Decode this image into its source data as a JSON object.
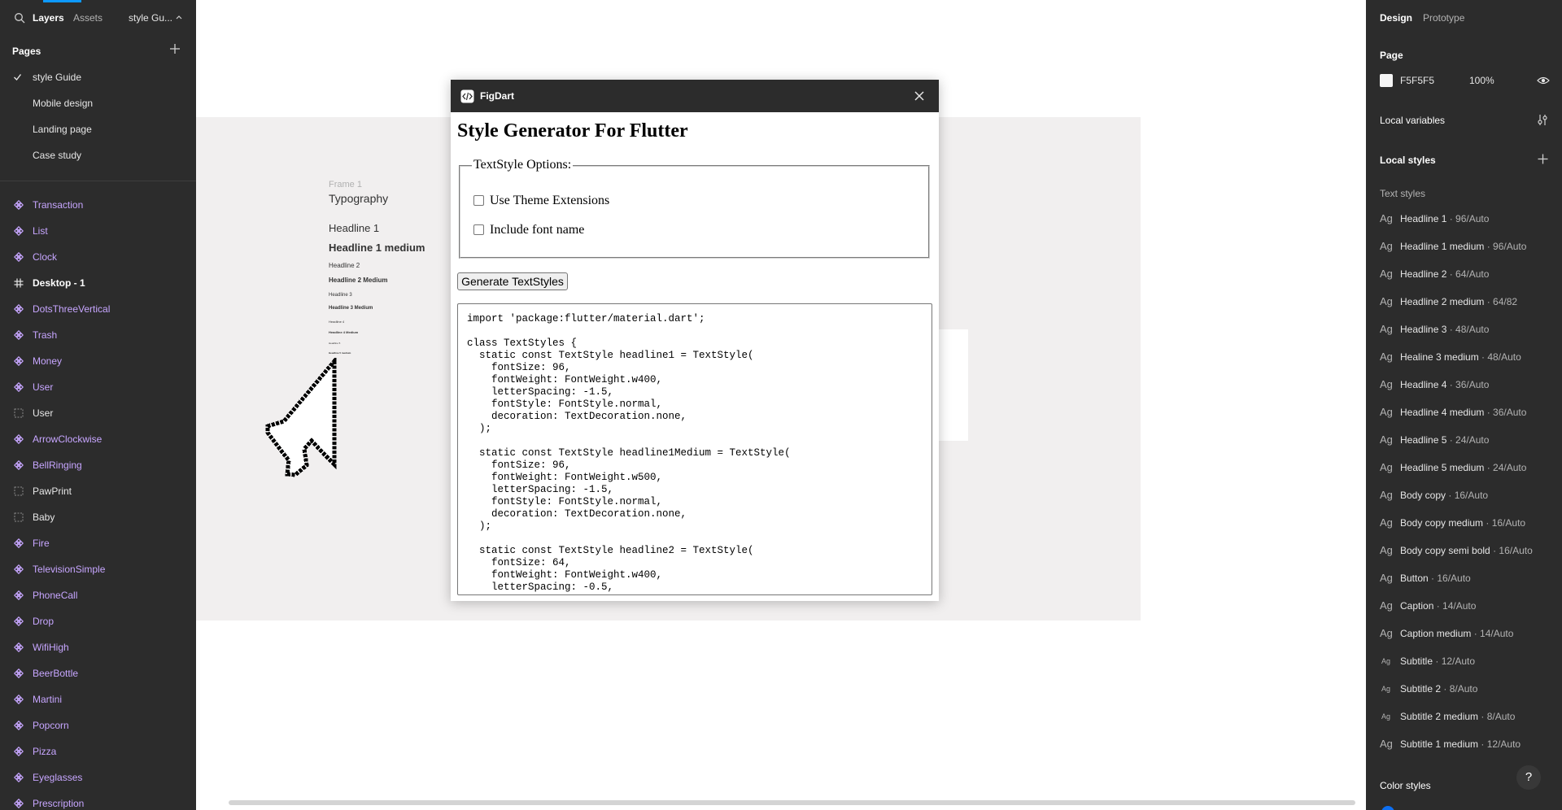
{
  "left_panel": {
    "tabs": {
      "layers": "Layers",
      "assets": "Assets"
    },
    "file_name": "style Gu...",
    "pages_heading": "Pages",
    "pages": [
      {
        "label": "style Guide",
        "selected": true
      },
      {
        "label": "Mobile design",
        "selected": false
      },
      {
        "label": "Landing page",
        "selected": false
      },
      {
        "label": "Case study",
        "selected": false
      }
    ],
    "layers": [
      {
        "label": "Transaction",
        "kind": "component"
      },
      {
        "label": "List",
        "kind": "component"
      },
      {
        "label": "Clock",
        "kind": "component"
      },
      {
        "label": "Desktop - 1",
        "kind": "frame"
      },
      {
        "label": "DotsThreeVertical",
        "kind": "component"
      },
      {
        "label": "Trash",
        "kind": "component"
      },
      {
        "label": "Money",
        "kind": "component"
      },
      {
        "label": "User",
        "kind": "component"
      },
      {
        "label": "User",
        "kind": "group"
      },
      {
        "label": "ArrowClockwise",
        "kind": "component"
      },
      {
        "label": "BellRinging",
        "kind": "component"
      },
      {
        "label": "PawPrint",
        "kind": "group"
      },
      {
        "label": "Baby",
        "kind": "group"
      },
      {
        "label": "Fire",
        "kind": "component"
      },
      {
        "label": "TelevisionSimple",
        "kind": "component"
      },
      {
        "label": "PhoneCall",
        "kind": "component"
      },
      {
        "label": "Drop",
        "kind": "component"
      },
      {
        "label": "WifiHigh",
        "kind": "component"
      },
      {
        "label": "BeerBottle",
        "kind": "component"
      },
      {
        "label": "Martini",
        "kind": "component"
      },
      {
        "label": "Popcorn",
        "kind": "component"
      },
      {
        "label": "Pizza",
        "kind": "component"
      },
      {
        "label": "Eyeglasses",
        "kind": "component"
      },
      {
        "label": "Prescription",
        "kind": "component"
      }
    ]
  },
  "canvas": {
    "frame_label": "Frame 1",
    "typography": [
      "Typography",
      "Headline 1",
      "Headline 1 medium",
      "Headline 2",
      "Headline 2 Medium",
      "Headline 3",
      "Headline 3 Medium",
      "Headline 4",
      "Headline 4 Medium",
      "Headline 5",
      "Headline 5 medium"
    ]
  },
  "plugin": {
    "name": "FigDart",
    "heading": "Style Generator For Flutter",
    "options_legend": "TextStyle Options:",
    "options": [
      {
        "label": "Use Theme Extensions",
        "checked": false
      },
      {
        "label": "Include font name",
        "checked": false
      }
    ],
    "generate_button": "Generate TextStyles",
    "code": "import 'package:flutter/material.dart';\n\nclass TextStyles {\n  static const TextStyle headline1 = TextStyle(\n    fontSize: 96,\n    fontWeight: FontWeight.w400,\n    letterSpacing: -1.5,\n    fontStyle: FontStyle.normal,\n    decoration: TextDecoration.none,\n  );\n\n  static const TextStyle headline1Medium = TextStyle(\n    fontSize: 96,\n    fontWeight: FontWeight.w500,\n    letterSpacing: -1.5,\n    fontStyle: FontStyle.normal,\n    decoration: TextDecoration.none,\n  );\n\n  static const TextStyle headline2 = TextStyle(\n    fontSize: 64,\n    fontWeight: FontWeight.w400,\n    letterSpacing: -0.5,"
  },
  "right_panel": {
    "tabs": {
      "design": "Design",
      "prototype": "Prototype"
    },
    "page_heading": "Page",
    "page_color": "F5F5F5",
    "page_opacity": "100%",
    "local_variables": "Local variables",
    "local_styles": "Local styles",
    "text_styles_heading": "Text styles",
    "text_styles": [
      {
        "name": "Headline 1",
        "meta": " · 96/Auto",
        "small": false
      },
      {
        "name": "Headline 1 medium",
        "meta": " · 96/Auto",
        "small": false
      },
      {
        "name": "Headline 2",
        "meta": " · 64/Auto",
        "small": false
      },
      {
        "name": "Headline 2 medium",
        "meta": " · 64/82",
        "small": false
      },
      {
        "name": "Headline 3",
        "meta": " · 48/Auto",
        "small": false
      },
      {
        "name": "Healine 3 medium",
        "meta": " · 48/Auto",
        "small": false
      },
      {
        "name": "Headline 4",
        "meta": " · 36/Auto",
        "small": false
      },
      {
        "name": "Headline 4 medium",
        "meta": " · 36/Auto",
        "small": false
      },
      {
        "name": "Headline 5",
        "meta": " · 24/Auto",
        "small": false
      },
      {
        "name": "Headline 5 medium",
        "meta": " · 24/Auto",
        "small": false
      },
      {
        "name": "Body copy",
        "meta": " · 16/Auto",
        "small": false
      },
      {
        "name": "Body copy medium",
        "meta": " · 16/Auto",
        "small": false
      },
      {
        "name": "Body copy semi bold",
        "meta": " · 16/Auto",
        "small": false
      },
      {
        "name": "Button",
        "meta": " · 16/Auto",
        "small": false
      },
      {
        "name": "Caption",
        "meta": " · 14/Auto",
        "small": false
      },
      {
        "name": "Caption medium",
        "meta": " · 14/Auto",
        "small": false
      },
      {
        "name": "Subtitle",
        "meta": " · 12/Auto",
        "small": true
      },
      {
        "name": "Subtitle 2",
        "meta": " · 8/Auto",
        "small": true
      },
      {
        "name": "Subtitle 2 medium",
        "meta": " · 8/Auto",
        "small": true
      },
      {
        "name": "Subtitle 1 medium",
        "meta": " · 12/Auto",
        "small": false
      }
    ],
    "glyph": "Ag",
    "color_styles_heading": "Color styles",
    "help_label": "?"
  },
  "colors": {
    "accent": "#0d99ff",
    "component_text": "#c7a6ff",
    "panel_bg": "#2c2c2c",
    "frame_bg": "#f1efef"
  },
  "icons": {
    "search": "search-icon",
    "plus": "plus-icon",
    "check": "check-icon",
    "component": "component-icon",
    "frame": "frame-hash-icon",
    "group": "group-dashed-icon",
    "close": "close-icon",
    "plugin": "code-icon",
    "eye": "eye-icon",
    "variables": "variables-icon",
    "cursor": "arrow-cursor-icon"
  }
}
